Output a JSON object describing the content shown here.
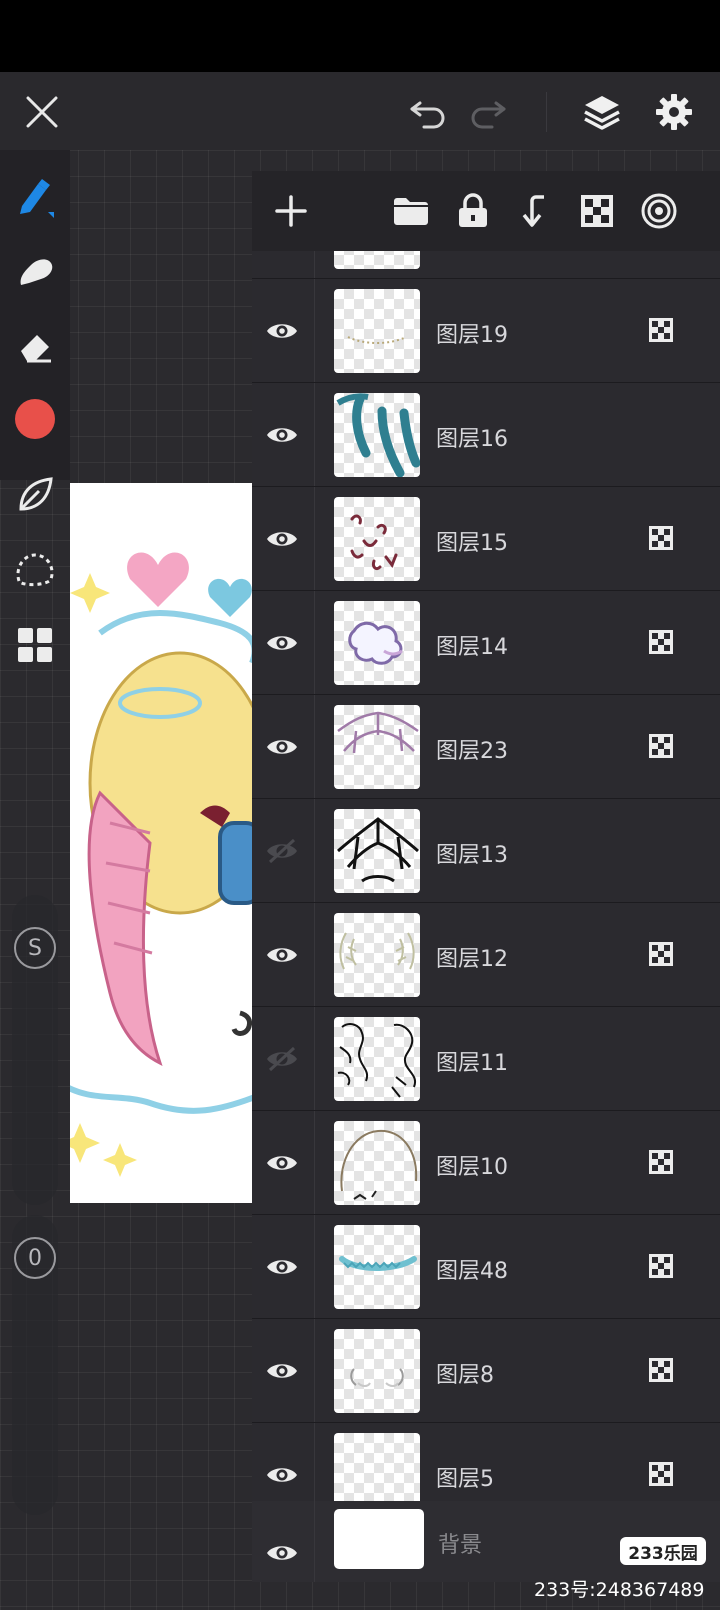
{
  "app": {
    "icons": {
      "close": "close-icon",
      "undo": "undo-icon",
      "redo": "redo-icon",
      "layers": "layers-icon",
      "settings": "gear-icon"
    },
    "accent_color": "#1e88e5",
    "brush_color": "#e8504a"
  },
  "toolbar": {
    "tools": [
      {
        "name": "pen-tool",
        "icon": "pen-icon",
        "active": true
      },
      {
        "name": "smudge-tool",
        "icon": "smudge-icon"
      },
      {
        "name": "eraser-tool",
        "icon": "eraser-icon"
      },
      {
        "name": "color-picker",
        "icon": "color-swatch-icon"
      },
      {
        "name": "fill-tool",
        "icon": "leaf-icon"
      },
      {
        "name": "selection-tool",
        "icon": "lasso-icon"
      },
      {
        "name": "grid-tool",
        "icon": "grid-icon"
      }
    ],
    "size_label": "S",
    "opacity_label": "0"
  },
  "layers_panel": {
    "toolbar_icons": [
      "add-layer-icon",
      "folder-icon",
      "lock-icon",
      "merge-down-icon",
      "transparency-icon",
      "blend-icon"
    ],
    "layers": [
      {
        "name": "图层19",
        "visible": true,
        "alpha_lock": true
      },
      {
        "name": "图层16",
        "visible": true,
        "alpha_lock": false
      },
      {
        "name": "图层15",
        "visible": true,
        "alpha_lock": true
      },
      {
        "name": "图层14",
        "visible": true,
        "alpha_lock": true
      },
      {
        "name": "图层23",
        "visible": true,
        "alpha_lock": true
      },
      {
        "name": "图层13",
        "visible": false,
        "alpha_lock": false
      },
      {
        "name": "图层12",
        "visible": true,
        "alpha_lock": true
      },
      {
        "name": "图层11",
        "visible": false,
        "alpha_lock": false
      },
      {
        "name": "图层10",
        "visible": true,
        "alpha_lock": true
      },
      {
        "name": "图层48",
        "visible": true,
        "alpha_lock": true
      },
      {
        "name": "图层8",
        "visible": true,
        "alpha_lock": true
      },
      {
        "name": "图层5",
        "visible": true,
        "alpha_lock": true
      }
    ],
    "background": {
      "name": "背景",
      "visible": true
    }
  },
  "watermark": {
    "logo": "233乐园",
    "id_text": "233号:248367489"
  }
}
